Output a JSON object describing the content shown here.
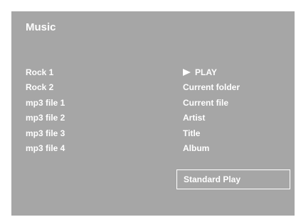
{
  "screen": {
    "title": "Music"
  },
  "files": [
    {
      "label": "Rock 1"
    },
    {
      "label": "Rock 2"
    },
    {
      "label": "mp3 file 1"
    },
    {
      "label": "mp3 file 2"
    },
    {
      "label": "mp3 file 3"
    },
    {
      "label": "mp3 file 4"
    }
  ],
  "menu": {
    "items": [
      {
        "label": "PLAY",
        "icon": "play-icon"
      },
      {
        "label": "Current folder"
      },
      {
        "label": "Current file"
      },
      {
        "label": "Artist"
      },
      {
        "label": "Title"
      },
      {
        "label": "Album"
      }
    ]
  },
  "play_mode": {
    "label": "Standard Play"
  },
  "colors": {
    "background": "#a6a6a6",
    "text": "#ffffff",
    "page": "#ffffff"
  }
}
